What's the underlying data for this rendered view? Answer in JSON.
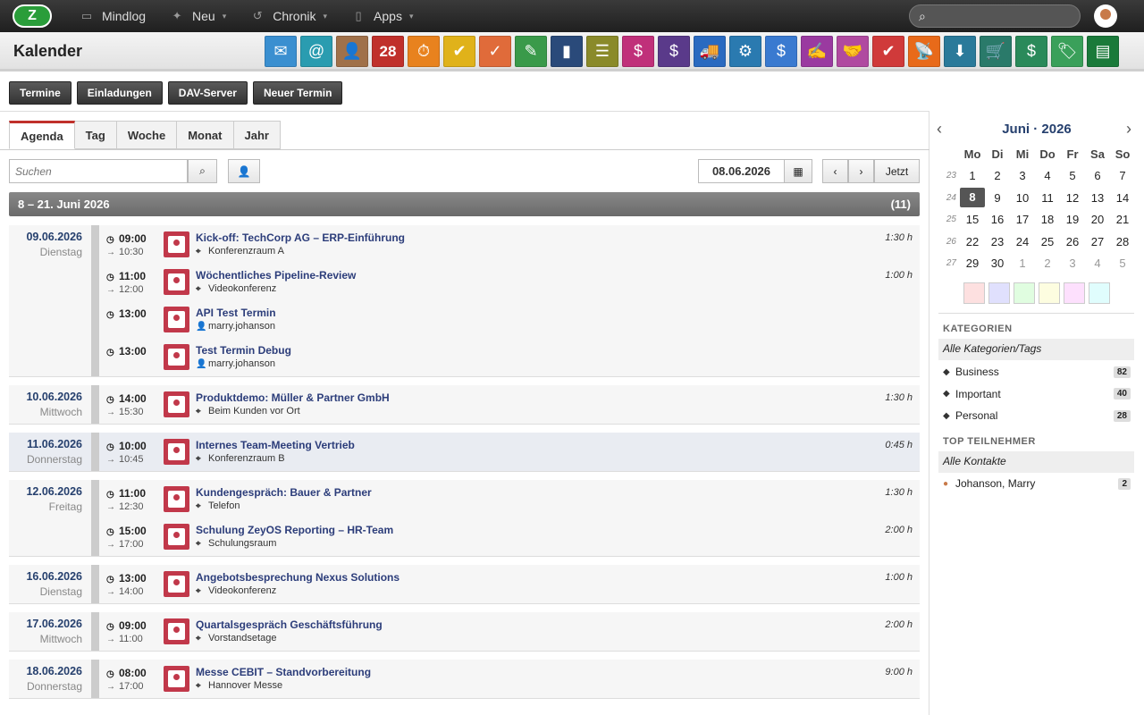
{
  "topbar": {
    "nav": [
      {
        "label": "Mindlog",
        "icon": "monitor-icon"
      },
      {
        "label": "Neu",
        "icon": "sparkle-icon"
      },
      {
        "label": "Chronik",
        "icon": "history-icon"
      },
      {
        "label": "Apps",
        "icon": "tablet-icon"
      }
    ]
  },
  "header": {
    "title": "Kalender"
  },
  "apps": [
    {
      "name": "mail-app-icon",
      "color": "#3a8fd0",
      "glyph": "✉"
    },
    {
      "name": "address-book-app-icon",
      "color": "#2a9cb0",
      "glyph": "@"
    },
    {
      "name": "contacts-app-icon",
      "color": "#a0714a",
      "glyph": "👤"
    },
    {
      "name": "calendar-app-icon",
      "color": "#c0302b",
      "glyph": "28"
    },
    {
      "name": "timer-app-icon",
      "color": "#e8821e",
      "glyph": "⏱"
    },
    {
      "name": "tasks-app-icon",
      "color": "#e0b21a",
      "glyph": "✔"
    },
    {
      "name": "projects-app-icon",
      "color": "#e06b3a",
      "glyph": "✓"
    },
    {
      "name": "notes-app-icon",
      "color": "#3a9a4a",
      "glyph": "✎"
    },
    {
      "name": "bookmarks-app-icon",
      "color": "#2a4a7a",
      "glyph": "▮"
    },
    {
      "name": "documents-app-icon",
      "color": "#8a8a2a",
      "glyph": "☰"
    },
    {
      "name": "pos-app-icon",
      "color": "#c0307a",
      "glyph": "$"
    },
    {
      "name": "finance-app-icon",
      "color": "#5a3a8a",
      "glyph": "$"
    },
    {
      "name": "logistics-app-icon",
      "color": "#2a6ac0",
      "glyph": "🚚"
    },
    {
      "name": "support-app-icon",
      "color": "#2a7ab0",
      "glyph": "⚙"
    },
    {
      "name": "money-app-icon",
      "color": "#3a7ad0",
      "glyph": "$"
    },
    {
      "name": "contracts-app-icon",
      "color": "#9a3aa0",
      "glyph": "✍"
    },
    {
      "name": "partners-app-icon",
      "color": "#b04aa0",
      "glyph": "🤝"
    },
    {
      "name": "invoices-app-icon",
      "color": "#d03a3a",
      "glyph": "✔"
    },
    {
      "name": "broadcast-app-icon",
      "color": "#e86a1a",
      "glyph": "📡"
    },
    {
      "name": "download-app-icon",
      "color": "#2a7a9a",
      "glyph": "⬇"
    },
    {
      "name": "cart-app-icon",
      "color": "#2a7a6a",
      "glyph": "🛒"
    },
    {
      "name": "payments-app-icon",
      "color": "#2a8a5a",
      "glyph": "$"
    },
    {
      "name": "pricing-app-icon",
      "color": "#3aa05a",
      "glyph": "🏷"
    },
    {
      "name": "database-app-icon",
      "color": "#1a7a3a",
      "glyph": "▤"
    }
  ],
  "toolbar": {
    "buttons": [
      "Termine",
      "Einladungen",
      "DAV-Server",
      "Neuer Termin"
    ]
  },
  "tabs": [
    "Agenda",
    "Tag",
    "Woche",
    "Monat",
    "Jahr"
  ],
  "search": {
    "placeholder": "Suchen"
  },
  "datefield": "08.06.2026",
  "now_label": "Jetzt",
  "range": {
    "label": "8 – 21. Juni 2026",
    "count": "(11)"
  },
  "days": [
    {
      "date": "09.06.2026",
      "weekday": "Dienstag",
      "events": [
        {
          "start": "09:00",
          "end": "10:30",
          "title": "Kick-off: TechCorp AG – ERP-Einführung",
          "loc": "Konferenzraum A",
          "loc_icon": "location-icon",
          "dur": "1:30 h"
        },
        {
          "start": "11:00",
          "end": "12:00",
          "title": "Wöchentliches Pipeline-Review",
          "loc": "Videokonferenz",
          "loc_icon": "location-icon",
          "dur": "1:00 h"
        },
        {
          "start": "13:00",
          "end": "",
          "title": "API Test Termin",
          "loc": "marry.johanson",
          "loc_icon": "user-icon",
          "dur": ""
        },
        {
          "start": "13:00",
          "end": "",
          "title": "Test Termin Debug",
          "loc": "marry.johanson",
          "loc_icon": "user-icon",
          "dur": ""
        }
      ]
    },
    {
      "date": "10.06.2026",
      "weekday": "Mittwoch",
      "events": [
        {
          "start": "14:00",
          "end": "15:30",
          "title": "Produktdemo: Müller & Partner GmbH",
          "loc": "Beim Kunden vor Ort",
          "loc_icon": "location-icon",
          "dur": "1:30 h"
        }
      ]
    },
    {
      "date": "11.06.2026",
      "weekday": "Donnerstag",
      "events": [
        {
          "start": "10:00",
          "end": "10:45",
          "title": "Internes Team-Meeting Vertrieb",
          "loc": "Konferenzraum B",
          "loc_icon": "location-icon",
          "dur": "0:45 h"
        }
      ]
    },
    {
      "date": "12.06.2026",
      "weekday": "Freitag",
      "events": [
        {
          "start": "11:00",
          "end": "12:30",
          "title": "Kundengespräch: Bauer & Partner",
          "loc": "Telefon",
          "loc_icon": "location-icon",
          "dur": "1:30 h"
        },
        {
          "start": "15:00",
          "end": "17:00",
          "title": "Schulung ZeyOS Reporting – HR-Team",
          "loc": "Schulungsraum",
          "loc_icon": "location-icon",
          "dur": "2:00 h"
        }
      ]
    },
    {
      "date": "16.06.2026",
      "weekday": "Dienstag",
      "events": [
        {
          "start": "13:00",
          "end": "14:00",
          "title": "Angebotsbesprechung Nexus Solutions",
          "loc": "Videokonferenz",
          "loc_icon": "location-icon",
          "dur": "1:00 h"
        }
      ]
    },
    {
      "date": "17.06.2026",
      "weekday": "Mittwoch",
      "events": [
        {
          "start": "09:00",
          "end": "11:00",
          "title": "Quartalsgespräch Geschäftsführung",
          "loc": "Vorstandsetage",
          "loc_icon": "location-icon",
          "dur": "2:00 h"
        }
      ]
    },
    {
      "date": "18.06.2026",
      "weekday": "Donnerstag",
      "events": [
        {
          "start": "08:00",
          "end": "17:00",
          "title": "Messe CEBIT – Standvorbereitung",
          "loc": "Hannover Messe",
          "loc_icon": "location-icon",
          "dur": "9:00 h"
        }
      ]
    }
  ],
  "minical": {
    "title": "Juni · 2026",
    "headers": [
      "Mo",
      "Di",
      "Mi",
      "Do",
      "Fr",
      "Sa",
      "So"
    ],
    "weeks": [
      {
        "wk": "23",
        "days": [
          "1",
          "2",
          "3",
          "4",
          "5",
          "6",
          "7"
        ]
      },
      {
        "wk": "24",
        "days": [
          "8",
          "9",
          "10",
          "11",
          "12",
          "13",
          "14"
        ]
      },
      {
        "wk": "25",
        "days": [
          "15",
          "16",
          "17",
          "18",
          "19",
          "20",
          "21"
        ]
      },
      {
        "wk": "26",
        "days": [
          "22",
          "23",
          "24",
          "25",
          "26",
          "27",
          "28"
        ]
      },
      {
        "wk": "27",
        "days": [
          "29",
          "30",
          "1",
          "2",
          "3",
          "4",
          "5"
        ]
      }
    ],
    "today": "8",
    "swatches": [
      "#fde0e0",
      "#e0e0fd",
      "#e0fde0",
      "#fdfde0",
      "#fde0fd",
      "#e0fdfd"
    ]
  },
  "categories": {
    "title": "KATEGORIEN",
    "all": "Alle Kategorien/Tags",
    "items": [
      {
        "label": "Business",
        "count": "82"
      },
      {
        "label": "Important",
        "count": "40"
      },
      {
        "label": "Personal",
        "count": "28"
      }
    ]
  },
  "participants": {
    "title": "TOP TEILNEHMER",
    "all": "Alle Kontakte",
    "items": [
      {
        "label": "Johanson, Marry",
        "count": "2"
      }
    ]
  }
}
